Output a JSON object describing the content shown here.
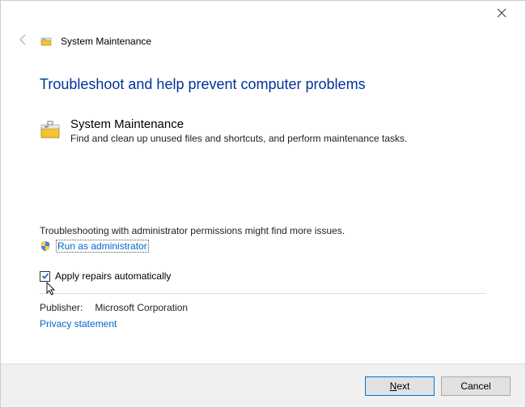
{
  "titlebar": {
    "close_label": "Close"
  },
  "header": {
    "window_title": "System Maintenance"
  },
  "main": {
    "heading": "Troubleshoot and help prevent computer problems",
    "hero_title": "System Maintenance",
    "hero_desc": "Find and clean up unused files and shortcuts, and perform maintenance tasks.",
    "admin_hint": "Troubleshooting with administrator permissions might find more issues.",
    "run_admin_link": "Run as administrator",
    "apply_repairs_label": "Apply repairs automatically",
    "apply_repairs_checked": true,
    "publisher_label": "Publisher:",
    "publisher_value": "Microsoft Corporation",
    "privacy_link": "Privacy statement"
  },
  "footer": {
    "next_label": "Next",
    "cancel_label": "Cancel"
  }
}
